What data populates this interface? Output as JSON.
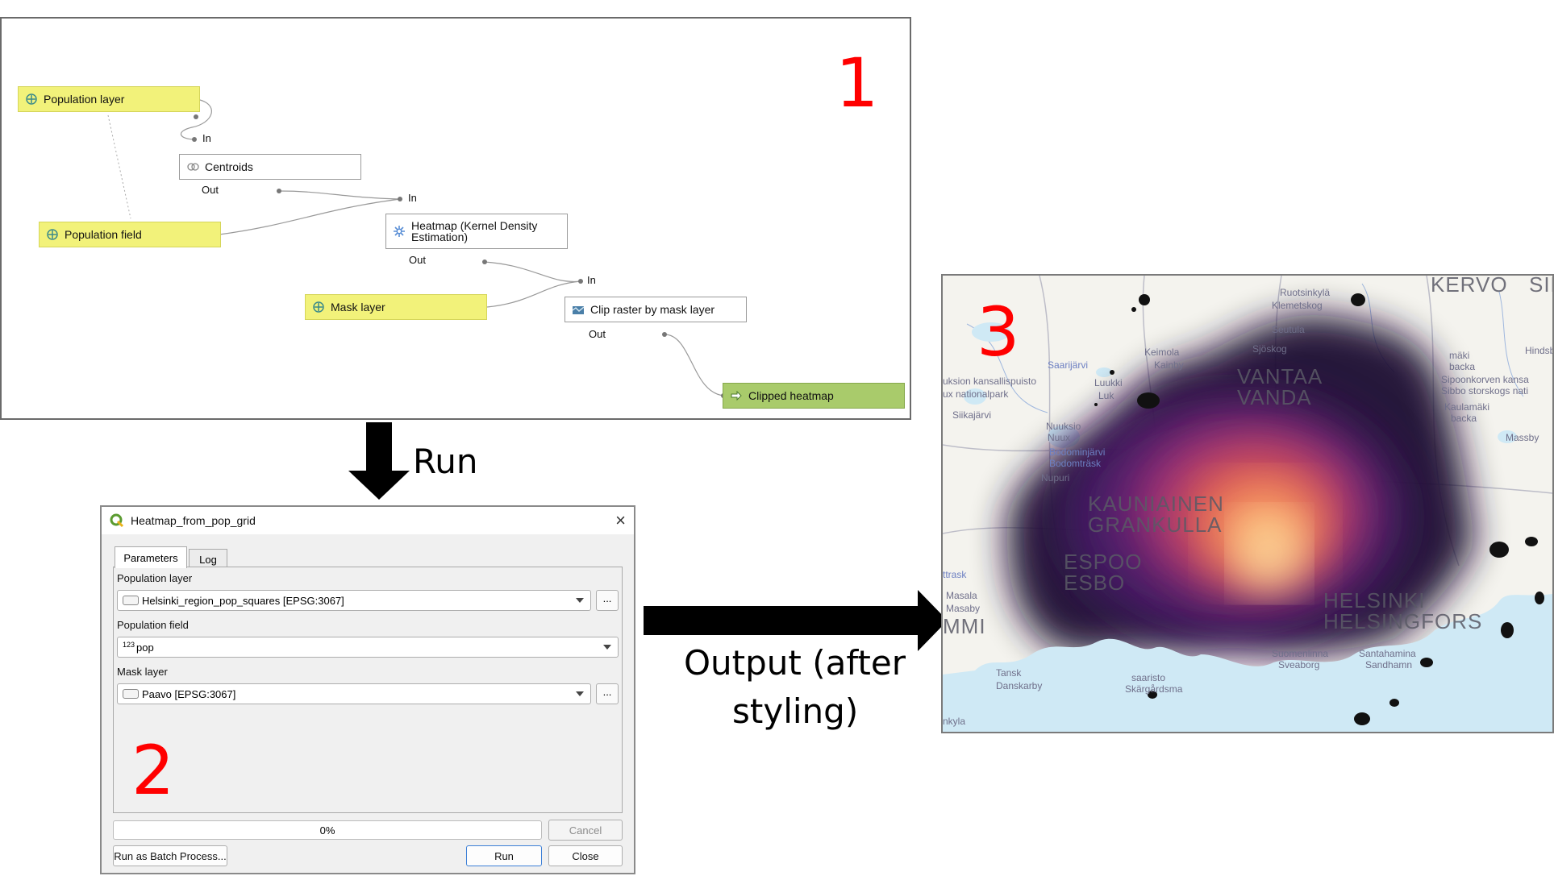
{
  "model": {
    "number": "1",
    "nodes": {
      "population_layer": "Population layer",
      "centroids": "Centroids",
      "population_field": "Population field",
      "heatmap": "Heatmap (Kernel Density Estimation)",
      "mask_layer": "Mask layer",
      "clip": "Clip raster by mask layer",
      "clipped": "Clipped heatmap"
    },
    "ports": {
      "in": "In",
      "out": "Out"
    }
  },
  "run_label": "Run",
  "output_label_line1": "Output (after",
  "output_label_line2": "styling)",
  "dialog": {
    "number": "2",
    "title": "Heatmap_from_pop_grid",
    "tabs": [
      "Parameters",
      "Log"
    ],
    "population_layer_label": "Population layer",
    "population_layer_value": "Helsinki_region_pop_squares [EPSG:3067]",
    "population_field_label": "Population field",
    "population_field_type": "123",
    "population_field_value": "pop",
    "mask_layer_label": "Mask layer",
    "mask_layer_value": "Paavo [EPSG:3067]",
    "browse_button": "...",
    "progress_text": "0%",
    "progress": 0,
    "cancel_button": "Cancel",
    "batch_button": "Run as Batch Process...",
    "run_button": "Run",
    "close_button": "Close"
  },
  "map": {
    "number": "3",
    "labels": {
      "kervo": "KERVO",
      "sip": "SIP",
      "ruotsinkyla": "Ruotsinkylä",
      "klemetskog": "Klemetskog",
      "seutula": "Seutula",
      "sjoskog": "Sjöskog",
      "keimola": "Keimola",
      "kainby": "Kainby",
      "saarijarvi": "Saarijärvi",
      "vantaa": "VANTAA",
      "vanda": "VANDA",
      "kansallispuisto": "uksion kansallispuisto",
      "nationalpark": "ux nationalpark",
      "luukki": "Luukki",
      "luk": "Luk",
      "siikajarvi": "Siikajärvi",
      "nuuksio": "Nuuksio",
      "nuux": "Nuux",
      "bodominjarvi": "Bodominjärvi",
      "bodomtrask": "Bodomträsk",
      "nupuri": "Nupuri",
      "kauniainen": "KAUNIAINEN",
      "grankulla": "GRANKULLA",
      "espoo": "ESPOO",
      "esbo": "ESBO",
      "masala": "Masala",
      "masaby": "Masaby",
      "mmi": "MMI",
      "trask": "ttrask",
      "helsinki": "HELSINKI",
      "helsingfors": "HELSINGFORS",
      "suomenlinna": "Suomenlinna",
      "sveaborg": "Sveaborg",
      "santahamina": "Santahamina",
      "sandhamn": "Sandhamn",
      "masby": "Massby",
      "hindsby": "Hindsby",
      "sipoonkorven": "Sipoonkorven kansa",
      "sibbo": "Sibbo storskogs nati",
      "kaulamaki": "Kaulamäki",
      "backa": "backa",
      "maki": "mäki",
      "backa2": "backa",
      "kirkkonummi_frag": "nkyla",
      "tanska": "Tansk",
      "danskarby": "Danskarby",
      "saaristo": "saaristo",
      "skargarden": "Skärgårdsma"
    }
  }
}
